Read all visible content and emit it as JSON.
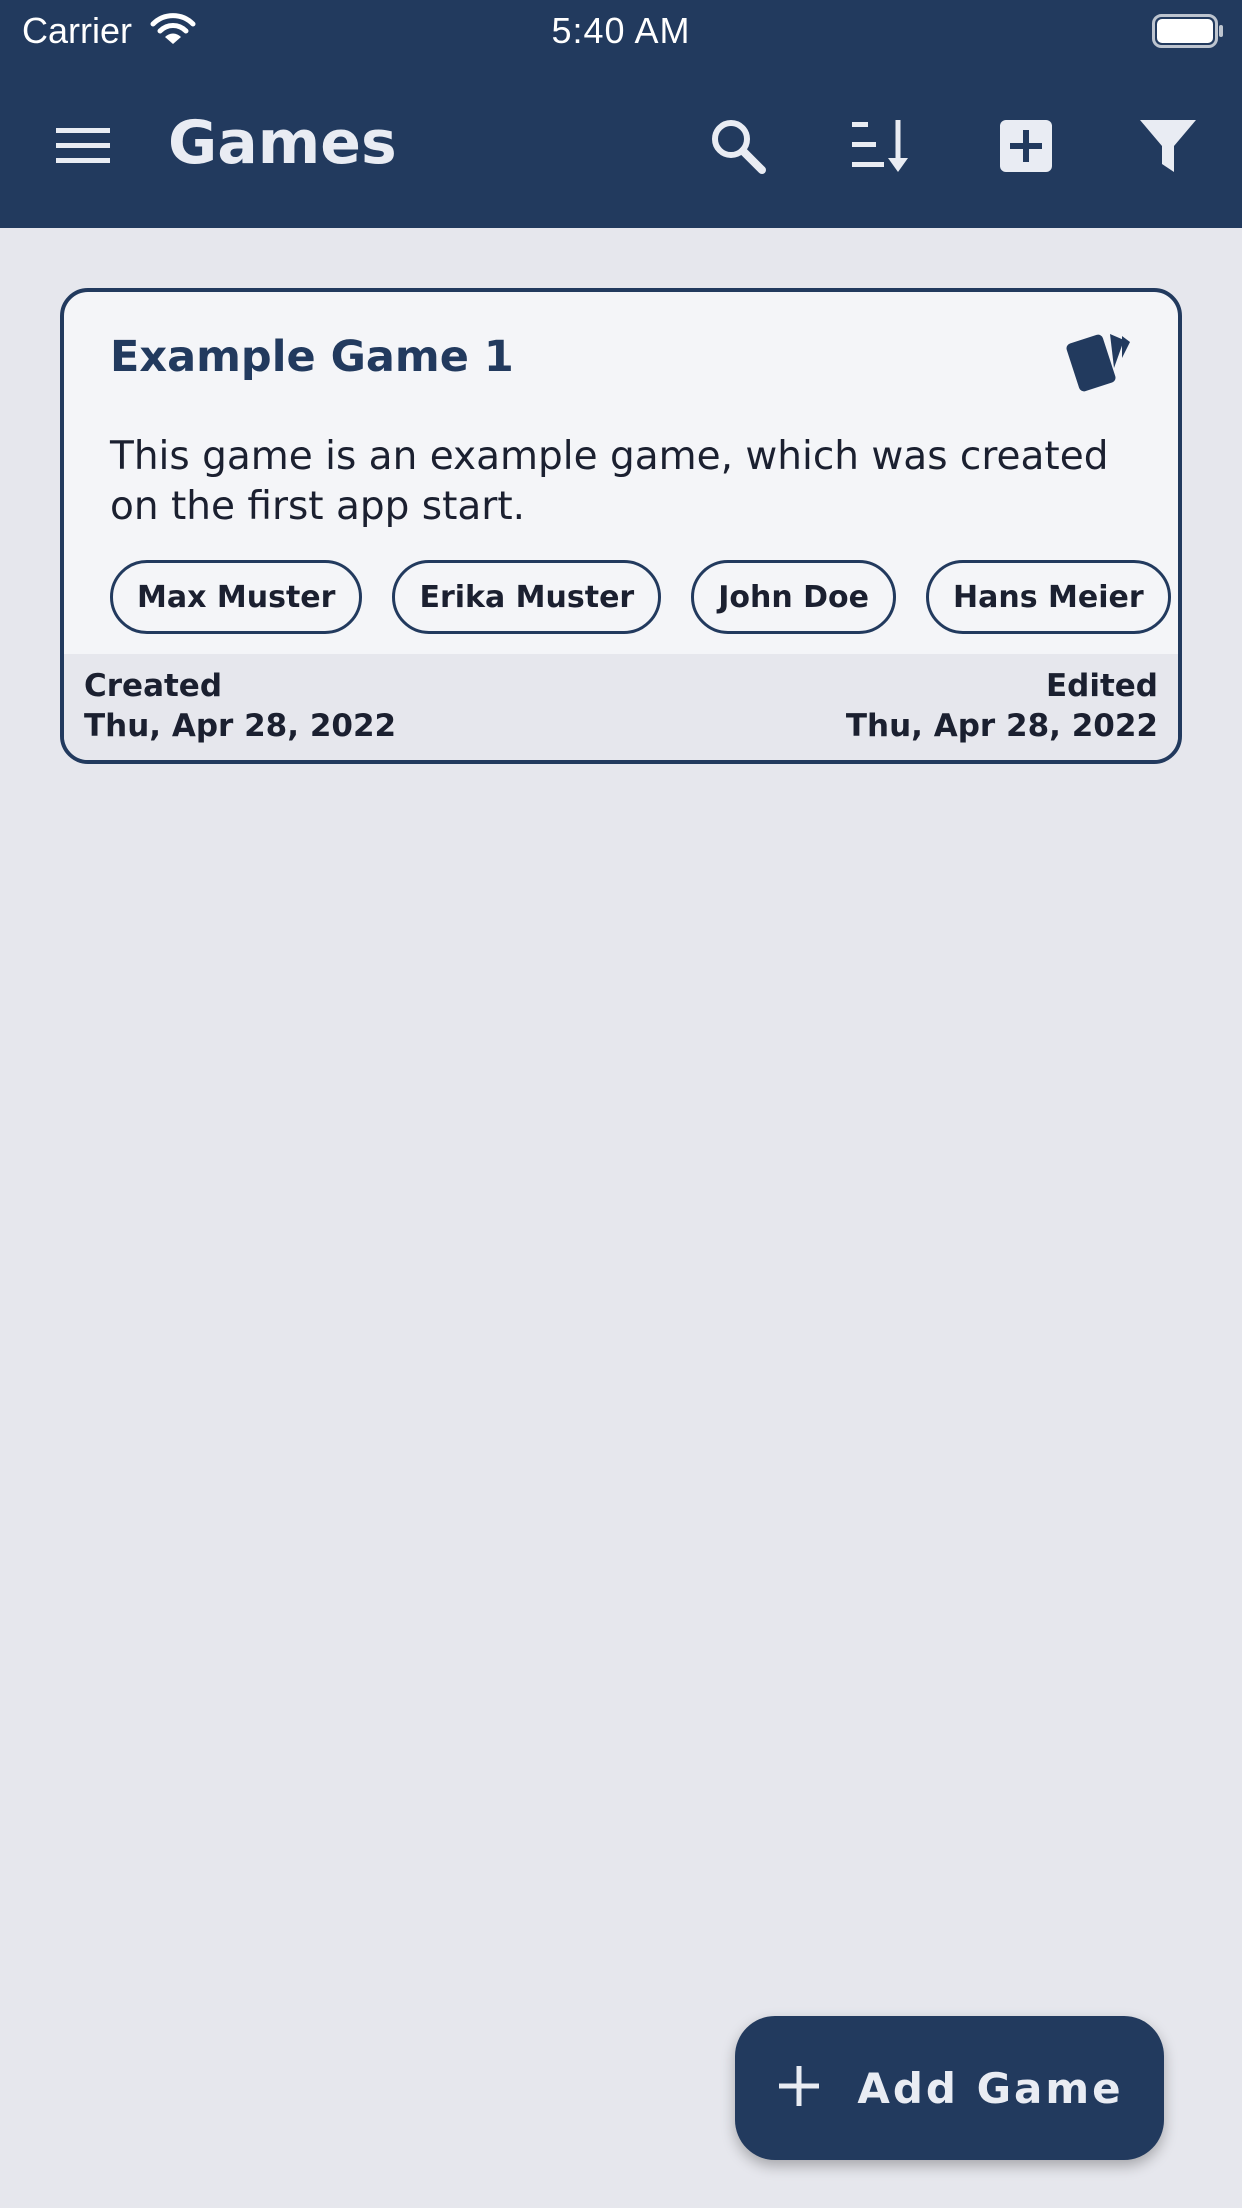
{
  "status_bar": {
    "carrier": "Carrier",
    "time": "5:40 AM"
  },
  "app_bar": {
    "title": "Games",
    "icons": [
      "menu-icon",
      "search-icon",
      "sort-icon",
      "add-box-icon",
      "filter-icon"
    ]
  },
  "games": [
    {
      "title": "Example Game 1",
      "icon": "cards-icon",
      "description": "This game is an example game, which was created on the first app start.",
      "players": [
        "Max Muster",
        "Erika Muster",
        "John Doe",
        "Hans Meier"
      ],
      "created_label": "Created",
      "created_date": "Thu, Apr 28, 2022",
      "edited_label": "Edited",
      "edited_date": "Thu, Apr 28, 2022"
    }
  ],
  "fab": {
    "label": "Add Game",
    "icon": "plus-icon"
  },
  "colors": {
    "primary": "#223a5e",
    "background": "#e6e7ed",
    "card": "#f4f5f8",
    "on_primary": "#e9ecf3"
  }
}
